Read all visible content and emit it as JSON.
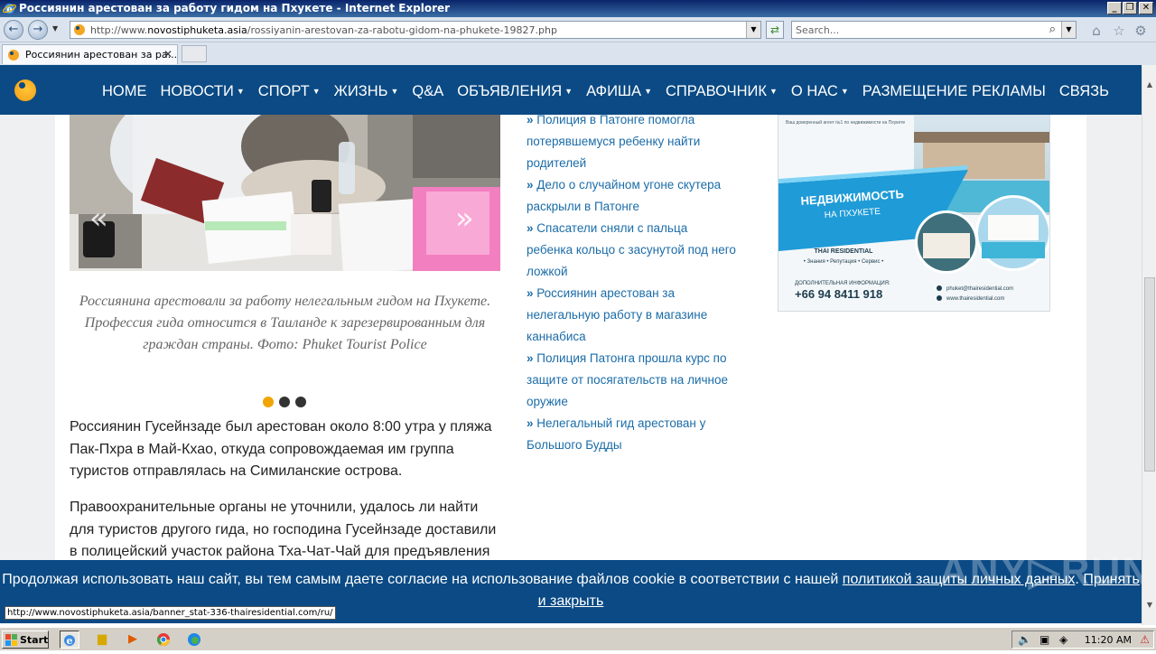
{
  "window": {
    "title": "Россиянин арестован за работу гидом на Пхукете - Internet Explorer",
    "buttons": [
      "_",
      "❐",
      "✕"
    ]
  },
  "browser": {
    "url_prefix": "http://www.",
    "url_domain": "novostiphuketa.asia",
    "url_path": "/rossiyanin-arestovan-za-rabotu-gidom-na-phukete-19827.php",
    "search_placeholder": "Search...",
    "tab_label": "Россиянин арестован за ра...",
    "tab_close": "✕"
  },
  "site_nav": {
    "items": [
      {
        "label": "HOME",
        "caret": false
      },
      {
        "label": "НОВОСТИ",
        "caret": true
      },
      {
        "label": "СПОРТ",
        "caret": true
      },
      {
        "label": "ЖИЗНЬ",
        "caret": true
      },
      {
        "label": "Q&A",
        "caret": false
      },
      {
        "label": "ОБЪЯВЛЕНИЯ",
        "caret": true
      },
      {
        "label": "АФИША",
        "caret": true
      },
      {
        "label": "СПРАВОЧНИК",
        "caret": true
      },
      {
        "label": "О НАС",
        "caret": true
      },
      {
        "label": "РАЗМЕЩЕНИЕ РЕКЛАМЫ",
        "caret": false
      },
      {
        "label": "СВЯЗЬ",
        "caret": false
      }
    ]
  },
  "slider": {
    "prev": "«",
    "next": "»",
    "caption": "Россиянина арестовали за работу нелегальным гидом на Пхукете. Профессия гида относится в Таиланде к зарезервированным для граждан страны. Фото: Phuket Tourist Police",
    "active_dot": 0,
    "dot_count": 3
  },
  "article": {
    "p1": "Россиянин Гусейнзаде был арестован около 8:00 утра у пляжа Пак-Пхра в Май-Кхао, откуда сопровождаемая им группа туристов отправлялась на Симиланские острова.",
    "p2": "Правоохранительные органы не уточнили, удалось ли найти для туристов другого гида, но господина Гусейнзаде доставили в полицейский участок района Тха-Чат-Чай для предъявления"
  },
  "related_links": [
    "Полиция в Патонге помогла потерявшемуся ребенку найти родителей",
    "Дело о случайном угоне скутера раскрыли в Патонге",
    "Спасатели сняли с пальца ребенка кольцо с засунутой под него ложкой",
    "Россиянин арестован за нелегальную работу в магазине каннабиса",
    "Полиция Патонга прошла курс по защите от посягательств на личное оружие",
    "Нелегальный гид арестован у Большого Будды"
  ],
  "ad": {
    "top_text": "Ваш доверенный агент №1 по недвижимости на Пхукете",
    "headline_1": "НЕДВИЖИМОСТЬ",
    "headline_2": "НА ПХУКЕТЕ",
    "brand": "THAI RESIDENTIAL",
    "tagline": "• Знания • Репутация • Сервис •",
    "info_label": "ДОПОЛНИТЕЛЬНАЯ ИНФОРМАЦИЯ:",
    "phone": "+66 94 8411 918",
    "email": "phuket@thairesidential.com",
    "site": "www.thairesidential.com"
  },
  "cookie": {
    "text": "Продолжая использовать наш сайт, вы тем самым даете согласие на использование файлов cookie в соответствии с нашей ",
    "link1": "политикой защиты личных данных",
    "sep": ". ",
    "link2": "Принять и закрыть"
  },
  "watermark": "ANY▷RUN",
  "status_url": "http://www.novostiphuketa.asia/banner_stat-336-thairesidential.com/ru/",
  "taskbar": {
    "start": "Start",
    "clock": "11:20 AM"
  },
  "colors": {
    "nav_bg": "#0b4a84",
    "link": "#1b6ca8",
    "dot_active": "#f0a500"
  }
}
